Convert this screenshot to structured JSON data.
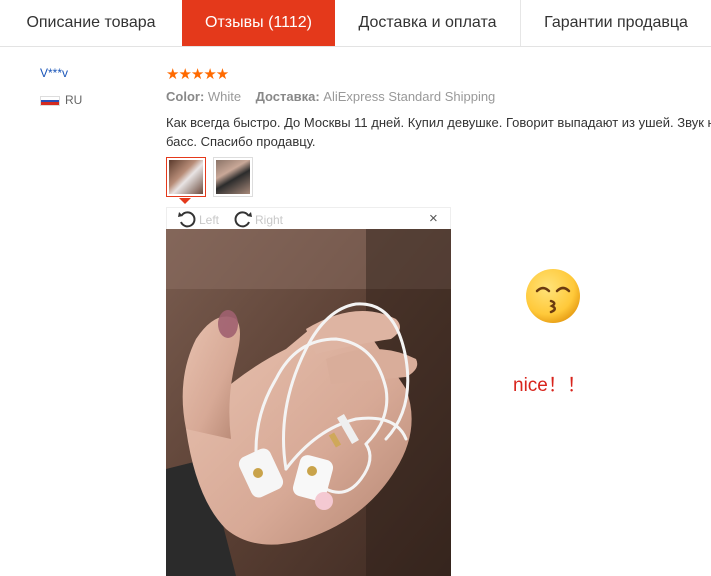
{
  "tabs": [
    {
      "label": "Описание товара",
      "active": false
    },
    {
      "label": "Отзывы (1112)",
      "active": true
    },
    {
      "label": "Доставка и оплата",
      "active": false
    },
    {
      "label": "Гарантии продавца",
      "active": false
    }
  ],
  "review": {
    "user": "V***v",
    "country": "RU",
    "rating": 5,
    "stars_text": "★★★★★",
    "color_label": "Color:",
    "color_value": "White",
    "delivery_label": "Доставка:",
    "delivery_value": "AliExpress Standard Shipping",
    "text_line1": "Как всегда быстро. До Москвы 11 дней. Купил девушке. Говорит выпадают из ушей. Звук нормальный,",
    "text_line2": "басс. Спасибо продавцу."
  },
  "viewer": {
    "rotate_left": "Left",
    "rotate_right": "Right",
    "close_glyph": "×"
  },
  "overlay": {
    "emoji_icon": "kissing-face-emoji",
    "nice_text": "nice！！"
  },
  "colors": {
    "accent": "#e4391b",
    "star": "#ff6a00",
    "username": "#1a55b8",
    "nice": "#d8241c"
  }
}
